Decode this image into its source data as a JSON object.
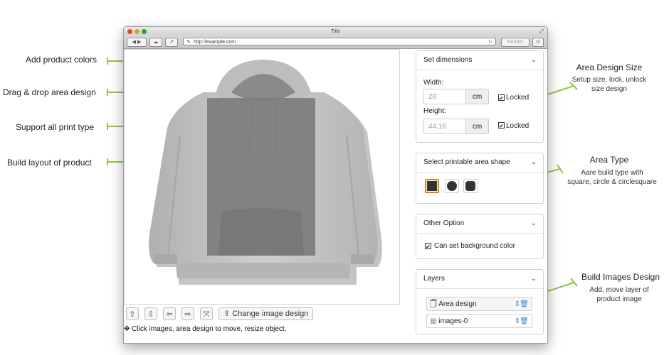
{
  "callouts_left": [
    "Add product colors",
    "Drag & drop area design",
    "Support all print type",
    "Build layout of product"
  ],
  "callouts_right": [
    {
      "title": "Area Design Size",
      "sub1": "Setup size, lock, unlock",
      "sub2": "size design"
    },
    {
      "title": "Area Type",
      "sub1": "Aare build type with",
      "sub2": "square, circle & circlesquare"
    },
    {
      "title": "Build Images Design",
      "sub1": "Add, move layer of",
      "sub2": "product image"
    }
  ],
  "browser": {
    "title": "Title",
    "url": "http://example.com",
    "reader_label": "Reader"
  },
  "controls": {
    "up": "⇧",
    "down": "⇩",
    "left": "⇦",
    "right": "⇨",
    "fit": "⤧",
    "change_image_label": "Change image design",
    "upload_icon": "⇪",
    "hint": "Click images, area design to move, resize object.",
    "move_icon": "✥"
  },
  "panels": {
    "dimensions": {
      "title": "Set dimensions",
      "width_label": "Width:",
      "width_value": "28",
      "height_label": "Height:",
      "height_value": "44.16",
      "unit": "cm",
      "locked_label": "Locked"
    },
    "shape": {
      "title": "Select printable area shape",
      "options": [
        "square",
        "circle",
        "circlesquare"
      ],
      "selected": "square"
    },
    "other": {
      "title": "Other Option",
      "bg_color_label": "Can set background color"
    },
    "layers": {
      "title": "Layers",
      "items": [
        {
          "name": "Area design",
          "icon": "clipboard-icon"
        },
        {
          "name": "images-0",
          "icon": "image-icon"
        }
      ]
    }
  },
  "colors": {
    "accent_green": "#8dc63f",
    "selected_orange": "#e07b1a",
    "design_area": "#7d7d7d",
    "link_blue": "#3a87c8"
  }
}
